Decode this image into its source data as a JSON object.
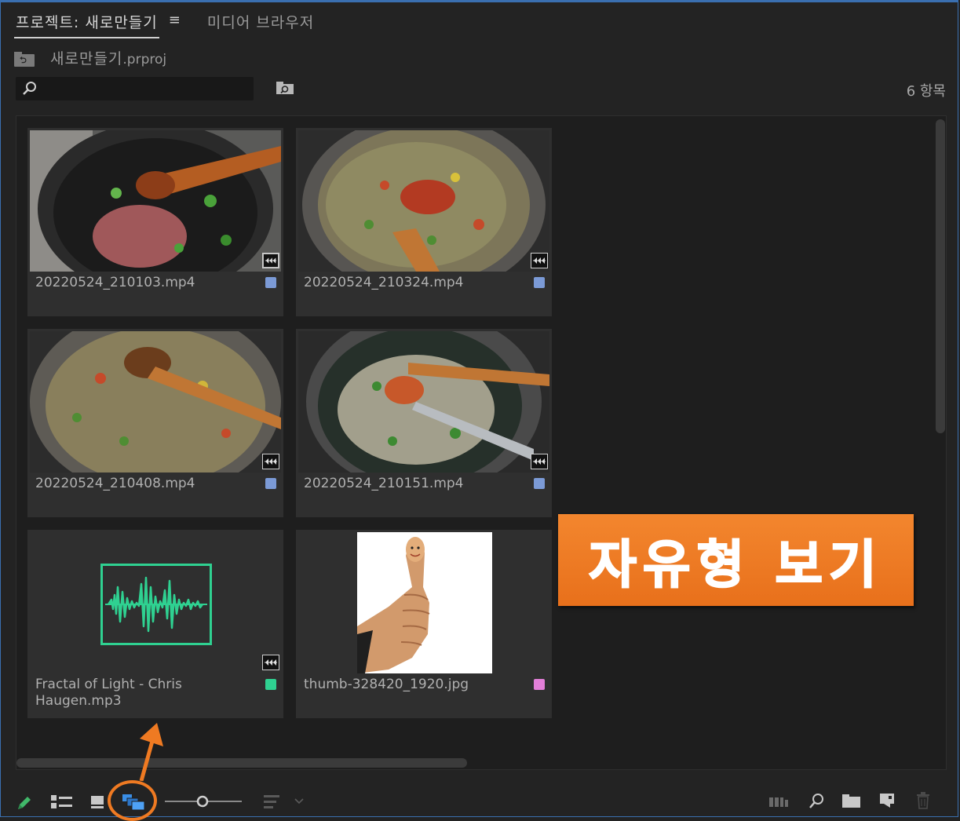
{
  "tabs": {
    "project_label": "프로젝트: 새로만들기",
    "project_menu": "≡",
    "media_browser_label": "미디어 브라우저"
  },
  "project": {
    "name_main": "새로만들기",
    "name_ext": ".prproj",
    "item_count": "6 항목"
  },
  "search": {
    "value": "",
    "placeholder": ""
  },
  "items": [
    {
      "name": "20220524_210103.mp4",
      "label_color": "#7b9ad6",
      "type": "video"
    },
    {
      "name": "20220524_210324.mp4",
      "label_color": "#7b9ad6",
      "type": "video"
    },
    {
      "name": "20220524_210408.mp4",
      "label_color": "#7b9ad6",
      "type": "video"
    },
    {
      "name": "20220524_210151.mp4",
      "label_color": "#7b9ad6",
      "type": "video"
    },
    {
      "name": "Fractal of Light - Chris Haugen.mp3",
      "label_color": "#2fd191",
      "type": "audio"
    },
    {
      "name": "thumb-328420_1920.jpg",
      "label_color": "#e27fd8",
      "type": "image"
    }
  ],
  "banner": {
    "text": "자유형 보기"
  },
  "toolbar": {
    "icons": [
      "pencil-icon",
      "list-view-icon",
      "icon-view-icon",
      "freeform-view-icon",
      "zoom-slider",
      "sort-icon",
      "automate-to-sequence-icon",
      "find-icon",
      "new-bin-icon",
      "new-item-icon",
      "clear-icon"
    ],
    "active": "freeform-view-icon",
    "zoom_level": 0.5
  },
  "colors": {
    "accent_blue": "#3a8ee6",
    "annotation_orange": "#ef7a22",
    "audio_waveform": "#2fd191"
  }
}
